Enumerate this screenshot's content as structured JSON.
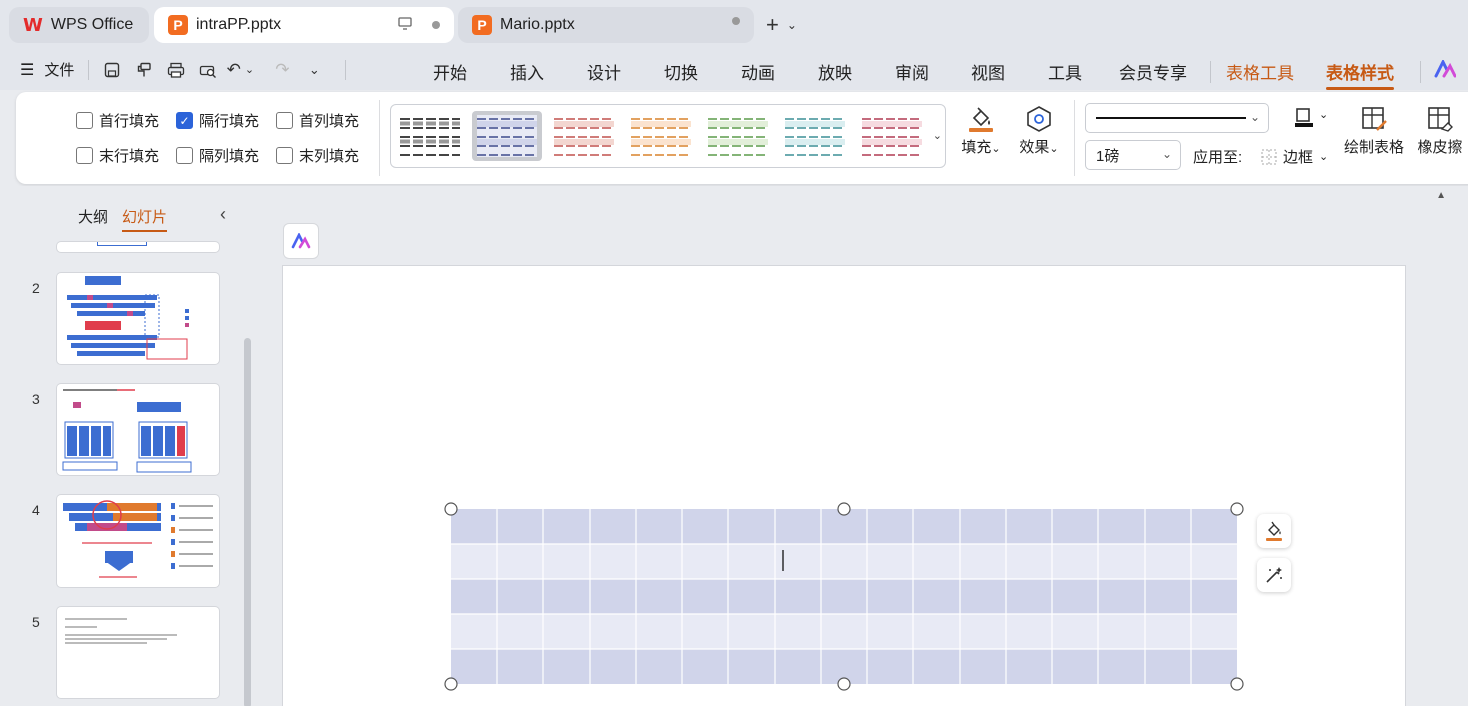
{
  "tabs": {
    "app_label": "WPS Office",
    "active_file": "intraPP.pptx",
    "other_file": "Mario.pptx"
  },
  "menubar": {
    "file_label": "文件",
    "tabs": [
      "开始",
      "插入",
      "设计",
      "切换",
      "动画",
      "放映",
      "审阅",
      "视图",
      "工具",
      "会员专享",
      "表格工具",
      "表格样式"
    ]
  },
  "ribbon": {
    "checkboxes": {
      "header_row": {
        "label": "首行填充",
        "checked": false
      },
      "banded_rows": {
        "label": "隔行填充",
        "checked": true
      },
      "first_column": {
        "label": "首列填充",
        "checked": false
      },
      "total_row": {
        "label": "末行填充",
        "checked": false
      },
      "banded_columns": {
        "label": "隔列填充",
        "checked": false
      },
      "last_column": {
        "label": "末列填充",
        "checked": false
      }
    },
    "fill_label": "填充",
    "effect_label": "效果",
    "border_width": "1磅",
    "apply_to_label": "应用至:",
    "border_label": "边框",
    "draw_table_label": "绘制表格",
    "eraser_label": "橡皮擦"
  },
  "left_panel": {
    "tab_outline": "大纲",
    "tab_slides": "幻灯片",
    "slide_numbers": [
      "2",
      "3",
      "4",
      "5"
    ]
  },
  "colors": {
    "accent": "#c75a15",
    "table_band_dark": "#d0d4ea",
    "table_band_light": "#e8eaf5",
    "checkbox_checked": "#2b63d9"
  }
}
